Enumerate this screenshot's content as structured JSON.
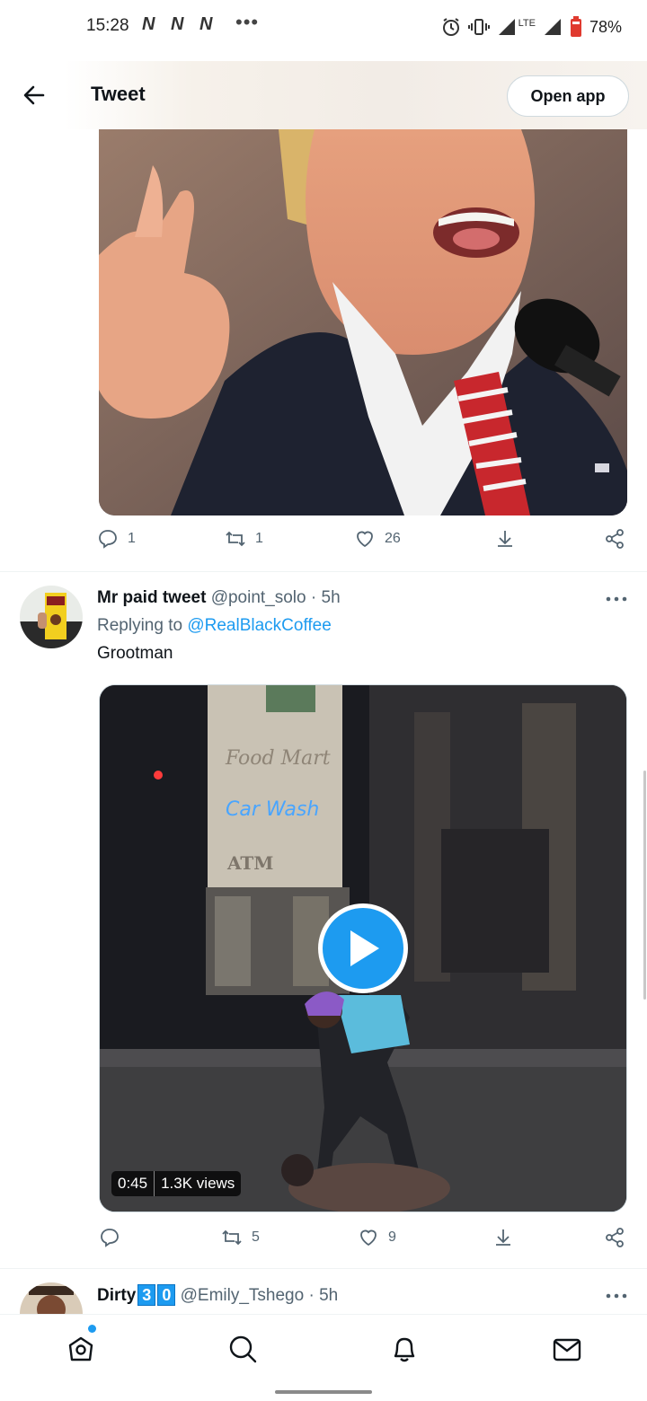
{
  "status_bar": {
    "time": "15:28",
    "carrier_icons": [
      "N",
      "N",
      "N"
    ],
    "more": "•••",
    "network": "LTE",
    "battery": "78%"
  },
  "header": {
    "title": "Tweet",
    "open_app_label": "Open app"
  },
  "tweet1": {
    "media": "photo",
    "replies": "1",
    "retweets": "1",
    "likes": "26"
  },
  "tweet2": {
    "name": "Mr paid tweet",
    "handle": "@point_solo",
    "time": "· 5h",
    "replying_prefix": "Replying to",
    "replying_to": "@RealBlackCoffee",
    "text": "Grootman",
    "video": {
      "duration": "0:45",
      "views": "1.3K views",
      "signs": [
        "Food Mart",
        "Car Wash",
        "ATM"
      ]
    },
    "replies": "",
    "retweets": "5",
    "likes": "9"
  },
  "tweet3": {
    "name": "Dirty",
    "badges": [
      "3",
      "0"
    ],
    "handle": "@Emily_Tshego",
    "time": "· 5h"
  },
  "bottom_nav": {
    "items": [
      "home-icon",
      "search-icon",
      "notifications-icon",
      "messages-icon"
    ],
    "accent": "#1d9bf0"
  }
}
